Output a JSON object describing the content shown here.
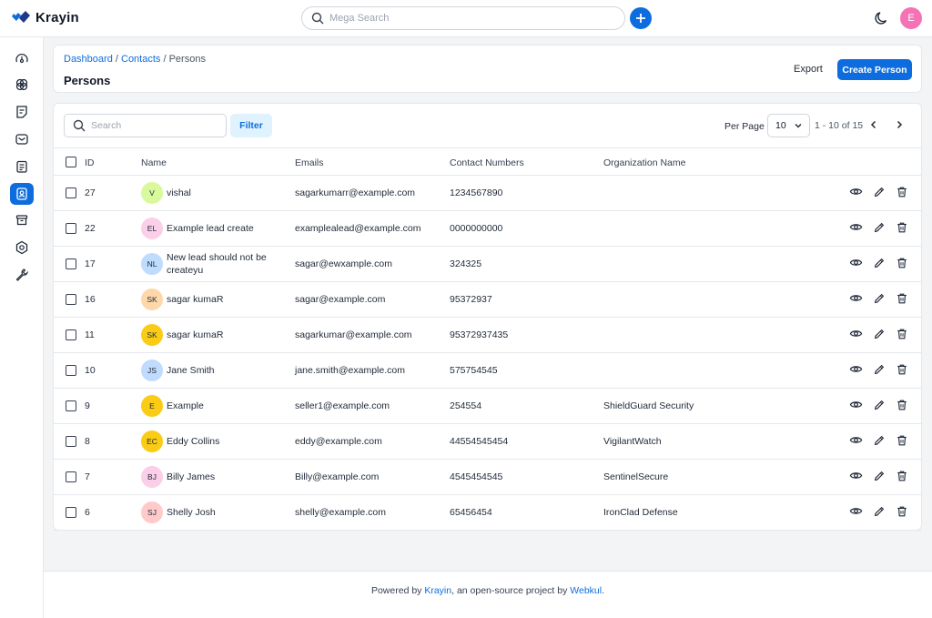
{
  "app": {
    "name": "Krayin"
  },
  "top": {
    "search_placeholder": "Mega Search",
    "avatar_letter": "E"
  },
  "sidebar": {
    "items": [
      "dashboard",
      "leads",
      "quotes",
      "mail",
      "activities",
      "contacts",
      "products",
      "settings",
      "configuration"
    ],
    "active": "contacts"
  },
  "breadcrumb": {
    "items": [
      "Dashboard",
      "Contacts"
    ],
    "current": "Persons",
    "separator": " / "
  },
  "page": {
    "title": "Persons",
    "export_label": "Export",
    "create_label": "Create Person"
  },
  "toolbar": {
    "search_placeholder": "Search",
    "filter_label": "Filter",
    "per_page_label": "Per Page",
    "per_page_value": "10",
    "pagination_info": "1 - 10 of 15"
  },
  "table": {
    "columns": [
      "ID",
      "Name",
      "Emails",
      "Contact Numbers",
      "Organization Name"
    ],
    "rows": [
      {
        "id": "27",
        "initials": "V",
        "avatar_color": "#d9f99d",
        "name": "vishal",
        "email": "sagarkumarr@example.com",
        "phone": "1234567890",
        "org": ""
      },
      {
        "id": "22",
        "initials": "EL",
        "avatar_color": "#fbcfe8",
        "name": "Example lead create",
        "email": "examplealead@example.com",
        "phone": "0000000000",
        "org": ""
      },
      {
        "id": "17",
        "initials": "NL",
        "avatar_color": "#bfdbfe",
        "name": "New lead should not be createyu",
        "email": "sagar@ewxample.com",
        "phone": "324325",
        "org": ""
      },
      {
        "id": "16",
        "initials": "SK",
        "avatar_color": "#fed7aa",
        "name": "sagar kumaR",
        "email": "sagar@example.com",
        "phone": "95372937",
        "org": ""
      },
      {
        "id": "11",
        "initials": "SK",
        "avatar_color": "#facc15",
        "name": "sagar kumaR",
        "email": "sagarkumar@example.com",
        "phone": "95372937435",
        "org": ""
      },
      {
        "id": "10",
        "initials": "JS",
        "avatar_color": "#bfdbfe",
        "name": "Jane Smith",
        "email": "jane.smith@example.com",
        "phone": "575754545",
        "org": ""
      },
      {
        "id": "9",
        "initials": "E",
        "avatar_color": "#facc15",
        "name": "Example",
        "email": "seller1@example.com",
        "phone": "254554",
        "org": "ShieldGuard Security"
      },
      {
        "id": "8",
        "initials": "EC",
        "avatar_color": "#facc15",
        "name": "Eddy Collins",
        "email": "eddy@example.com",
        "phone": "44554545454",
        "org": "VigilantWatch"
      },
      {
        "id": "7",
        "initials": "BJ",
        "avatar_color": "#fbcfe8",
        "name": "Billy James",
        "email": "Billy@example.com",
        "phone": "4545454545",
        "org": "SentinelSecure"
      },
      {
        "id": "6",
        "initials": "SJ",
        "avatar_color": "#fecaca",
        "name": "Shelly Josh",
        "email": "shelly@example.com",
        "phone": "65456454",
        "org": "IronClad Defense"
      }
    ]
  },
  "footer": {
    "prefix": "Powered by ",
    "link1": "Krayin",
    "middle": ", an open-source project by ",
    "link2": "Webkul",
    "suffix": "."
  },
  "colors": {
    "accent": "#0e6dde",
    "filter_bg": "#e0f2fe",
    "avatar_top": "#f472b6"
  }
}
